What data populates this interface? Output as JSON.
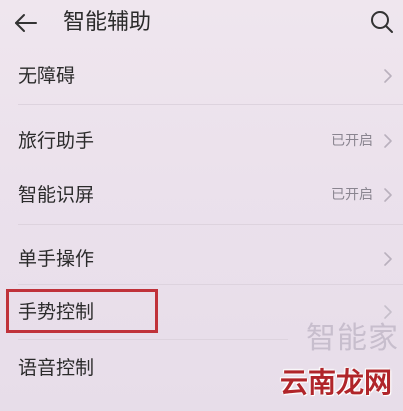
{
  "header": {
    "title": "智能辅助"
  },
  "settings": {
    "items": [
      {
        "label": "无障碍",
        "status": ""
      },
      {
        "label": "旅行助手",
        "status": "已开启"
      },
      {
        "label": "智能识屏",
        "status": "已开启"
      },
      {
        "label": "单手操作",
        "status": ""
      },
      {
        "label": "手势控制",
        "status": ""
      },
      {
        "label": "语音控制",
        "status": ""
      }
    ]
  },
  "watermark": {
    "faint_text": "智能家",
    "brand_text": "云南龙网"
  },
  "colors": {
    "background": "#ede3ed",
    "highlight_border": "#c0323a",
    "status_text": "#8a8590",
    "brand_red": "#b0252a"
  }
}
